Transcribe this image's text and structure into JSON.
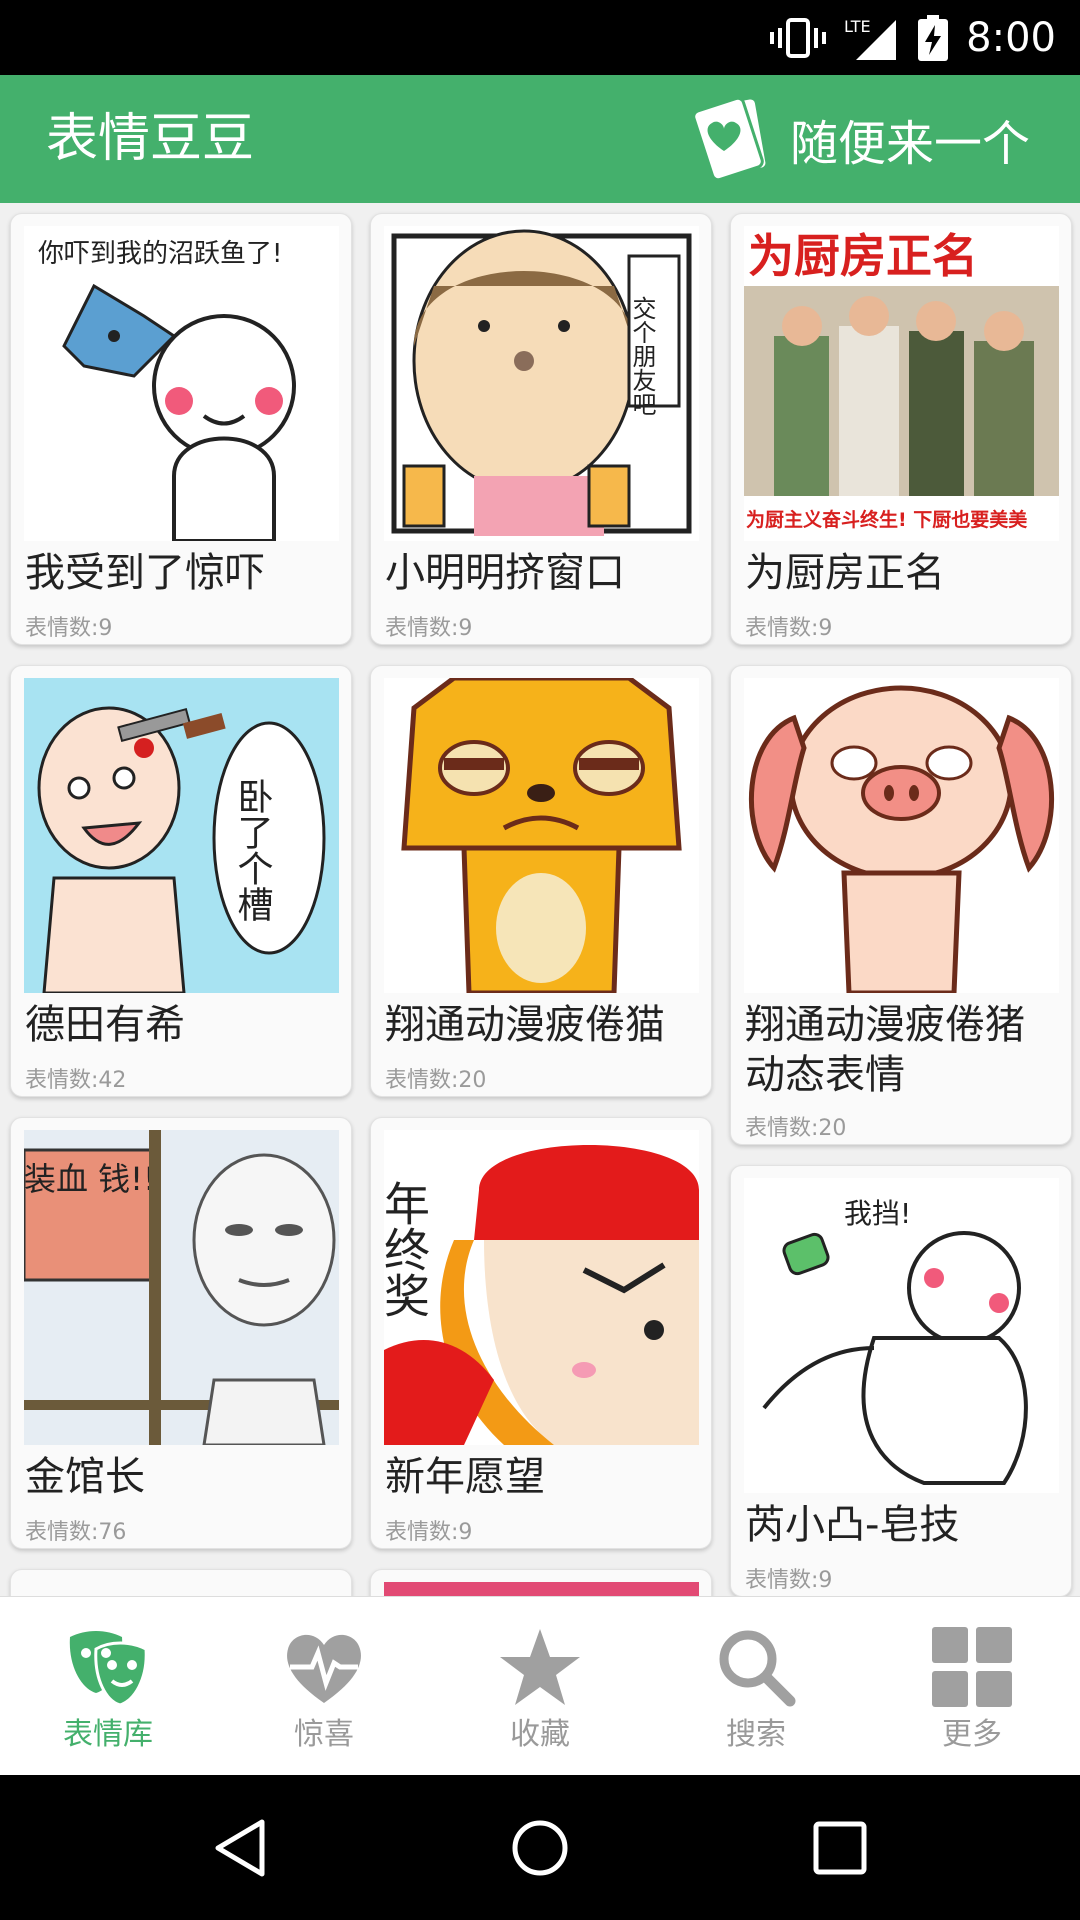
{
  "status_bar": {
    "time": "8:00",
    "icons": [
      "vibrate-icon",
      "lte-signal-icon",
      "battery-charging-icon"
    ],
    "lte_label": "LTE"
  },
  "app_bar": {
    "title": "表情豆豆",
    "random_label": "随便来一个",
    "accent": "#44b06c"
  },
  "cards": [
    {
      "title": "我受到了惊吓",
      "count": "表情数:9"
    },
    {
      "title": "小明明挤窗口",
      "count": "表情数:9"
    },
    {
      "title": "为厨房正名",
      "count": "表情数:9"
    },
    {
      "title": "德田有希",
      "count": "表情数:42"
    },
    {
      "title": "翔通动漫疲倦猫",
      "count": "表情数:20"
    },
    {
      "title": "翔通动漫疲倦猪动态表情",
      "count": "表情数:20"
    },
    {
      "title": "金馆长",
      "count": "表情数:76"
    },
    {
      "title": "新年愿望",
      "count": "表情数:9"
    },
    {
      "title": "芮小凸-皂技",
      "count": "表情数:9"
    }
  ],
  "thumb_text": {
    "card1": "你吓到我的沼跃鱼了!",
    "card2": "交个朋友吧",
    "card3_top": "为厨房正名",
    "card3_bottom": "为厨主义奋斗终生! 下厨也要美美",
    "card4": "卧了个槽",
    "card7": "装血 钱!!",
    "card8": "年终奖",
    "card9": "我挡!"
  },
  "bottom_nav": [
    {
      "label": "表情库",
      "icon": "mask-icon",
      "active": true
    },
    {
      "label": "惊喜",
      "icon": "heart-pulse-icon",
      "active": false
    },
    {
      "label": "收藏",
      "icon": "star-icon",
      "active": false
    },
    {
      "label": "搜索",
      "icon": "search-icon",
      "active": false
    },
    {
      "label": "更多",
      "icon": "grid-icon",
      "active": false
    }
  ],
  "system_nav": [
    "back-icon",
    "home-icon",
    "recents-icon"
  ]
}
